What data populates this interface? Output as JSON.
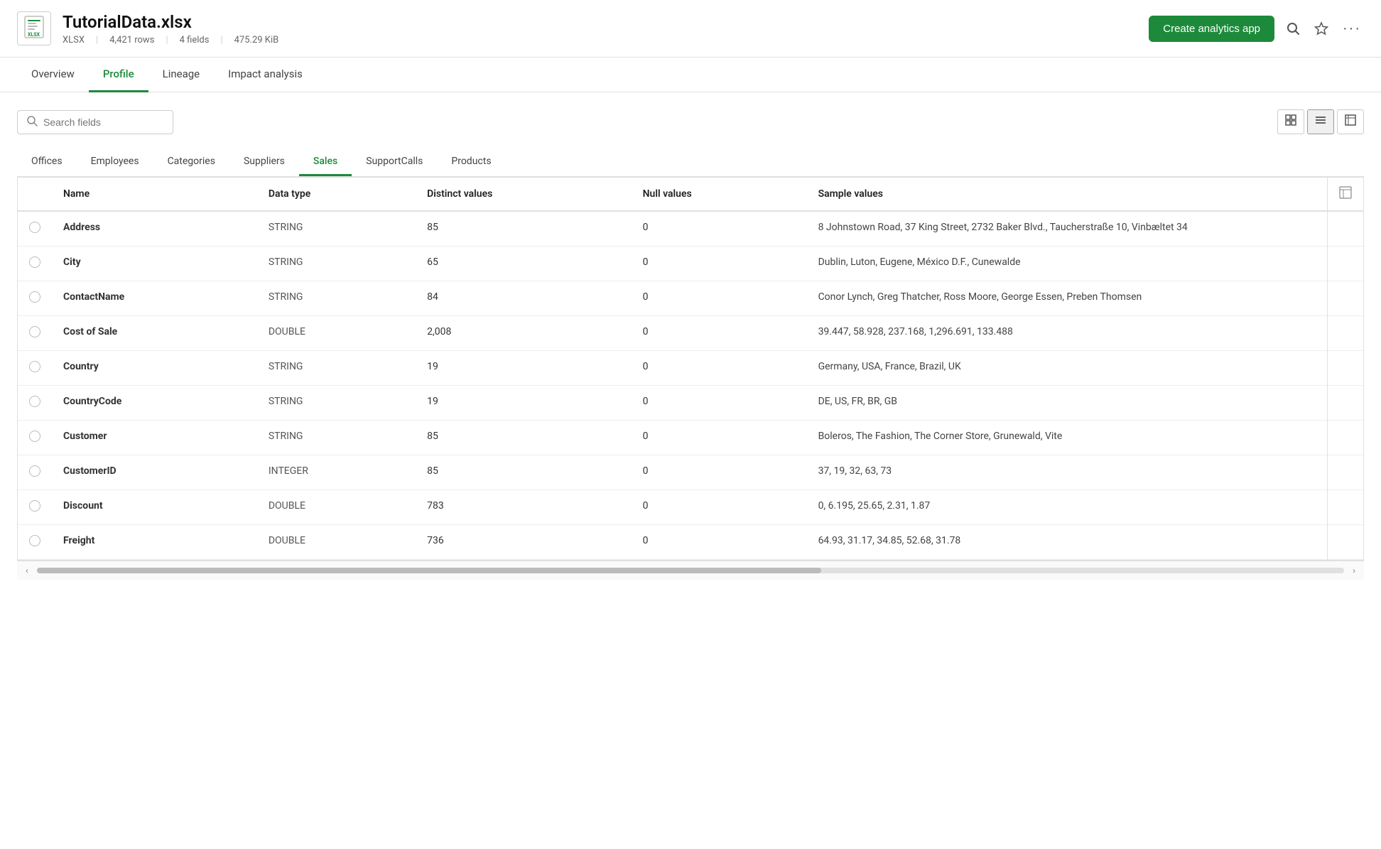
{
  "header": {
    "filename": "TutorialData.xlsx",
    "filetype": "XLSX",
    "rows": "4,421 rows",
    "fields": "4 fields",
    "filesize": "475.29 KiB",
    "create_btn": "Create analytics app"
  },
  "nav": {
    "tabs": [
      {
        "id": "overview",
        "label": "Overview",
        "active": false
      },
      {
        "id": "profile",
        "label": "Profile",
        "active": true
      },
      {
        "id": "lineage",
        "label": "Lineage",
        "active": false
      },
      {
        "id": "impact",
        "label": "Impact analysis",
        "active": false
      }
    ]
  },
  "toolbar": {
    "search_placeholder": "Search fields"
  },
  "sheet_tabs": [
    {
      "id": "offices",
      "label": "Offices",
      "active": false
    },
    {
      "id": "employees",
      "label": "Employees",
      "active": false
    },
    {
      "id": "categories",
      "label": "Categories",
      "active": false
    },
    {
      "id": "suppliers",
      "label": "Suppliers",
      "active": false
    },
    {
      "id": "sales",
      "label": "Sales",
      "active": true
    },
    {
      "id": "supportcalls",
      "label": "SupportCalls",
      "active": false
    },
    {
      "id": "products",
      "label": "Products",
      "active": false
    }
  ],
  "table": {
    "columns": [
      {
        "id": "select",
        "label": ""
      },
      {
        "id": "name",
        "label": "Name"
      },
      {
        "id": "data_type",
        "label": "Data type"
      },
      {
        "id": "distinct_values",
        "label": "Distinct values"
      },
      {
        "id": "null_values",
        "label": "Null values"
      },
      {
        "id": "sample_values",
        "label": "Sample values"
      }
    ],
    "rows": [
      {
        "name": "Address",
        "data_type": "STRING",
        "distinct_values": "85",
        "null_values": "0",
        "sample_values": "8 Johnstown Road, 37 King Street, 2732 Baker Blvd., Taucherstraße 10, Vinbæltet 34"
      },
      {
        "name": "City",
        "data_type": "STRING",
        "distinct_values": "65",
        "null_values": "0",
        "sample_values": "Dublin, Luton, Eugene, México D.F., Cunewalde"
      },
      {
        "name": "ContactName",
        "data_type": "STRING",
        "distinct_values": "84",
        "null_values": "0",
        "sample_values": "Conor Lynch, Greg Thatcher, Ross Moore, George Essen, Preben Thomsen"
      },
      {
        "name": "Cost of Sale",
        "data_type": "DOUBLE",
        "distinct_values": "2,008",
        "null_values": "0",
        "sample_values": "39.447, 58.928, 237.168, 1,296.691, 133.488"
      },
      {
        "name": "Country",
        "data_type": "STRING",
        "distinct_values": "19",
        "null_values": "0",
        "sample_values": "Germany, USA, France, Brazil, UK"
      },
      {
        "name": "CountryCode",
        "data_type": "STRING",
        "distinct_values": "19",
        "null_values": "0",
        "sample_values": "DE, US, FR, BR, GB"
      },
      {
        "name": "Customer",
        "data_type": "STRING",
        "distinct_values": "85",
        "null_values": "0",
        "sample_values": "Boleros, The Fashion, The Corner Store, Grunewald, Vite"
      },
      {
        "name": "CustomerID",
        "data_type": "INTEGER",
        "distinct_values": "85",
        "null_values": "0",
        "sample_values": "37, 19, 32, 63, 73"
      },
      {
        "name": "Discount",
        "data_type": "DOUBLE",
        "distinct_values": "783",
        "null_values": "0",
        "sample_values": "0, 6.195, 25.65, 2.31, 1.87"
      },
      {
        "name": "Freight",
        "data_type": "DOUBLE",
        "distinct_values": "736",
        "null_values": "0",
        "sample_values": "64.93, 31.17, 34.85, 52.68, 31.78"
      }
    ]
  }
}
